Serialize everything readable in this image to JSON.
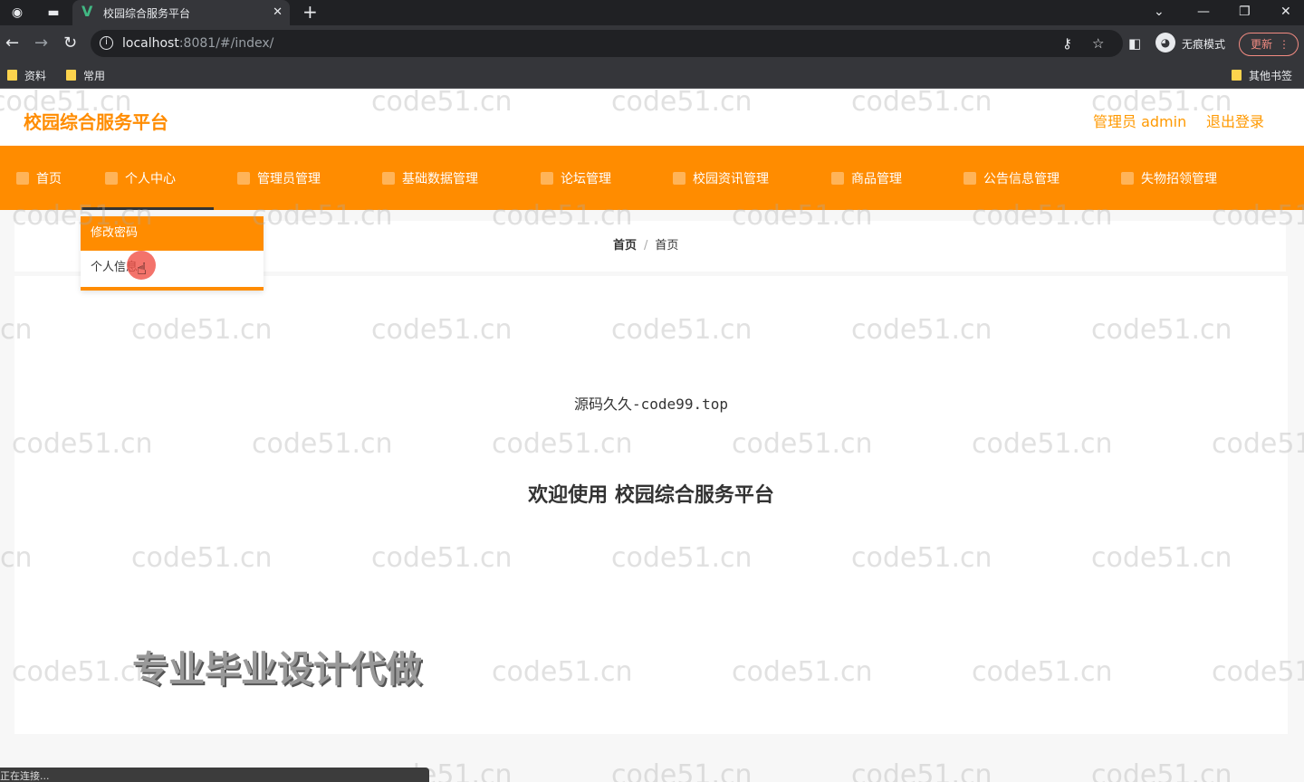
{
  "browser": {
    "tab_title": "校园综合服务平台",
    "tab_logo": "V",
    "url_host": "localhost",
    "url_rest": ":8081/#/index/",
    "incognito_label": "无痕模式",
    "update_label": "更新",
    "bookmarks": [
      "资料",
      "常用"
    ],
    "other_bookmarks": "其他书签",
    "status": "正在连接..."
  },
  "header": {
    "brand": "校园综合服务平台",
    "user": "管理员 admin",
    "logout": "退出登录"
  },
  "nav": {
    "items": [
      "首页",
      "个人中心",
      "管理员管理",
      "基础数据管理",
      "论坛管理",
      "校园资讯管理",
      "商品管理",
      "公告信息管理",
      "失物招领管理"
    ]
  },
  "dropdown": {
    "items": [
      "修改密码",
      "个人信息"
    ]
  },
  "breadcrumb": {
    "first": "首页",
    "separator": "/",
    "second": "首页"
  },
  "main": {
    "code_line": "源码久久-code99.top",
    "welcome": "欢迎使用 校园综合服务平台",
    "promo": "专业毕业设计代做"
  },
  "watermark": "code51.cn",
  "colors": {
    "accent": "#ff8c00",
    "accent_text": "#ff9900"
  }
}
